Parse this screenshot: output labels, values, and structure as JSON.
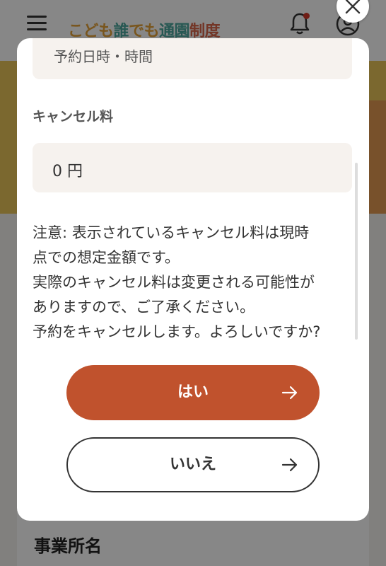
{
  "header": {
    "logo_parts": [
      "こども",
      "誰",
      "でも",
      "通園",
      "制度"
    ]
  },
  "background": {
    "section_title": "事業所名"
  },
  "modal": {
    "previous_field_value": "予約日時・時間",
    "cancel_fee_label": "キャンセル料",
    "cancel_fee_value": "0 円",
    "notice_lines": [
      "注意: 表示されているキャンセル料は現時",
      "点での想定金額です。",
      "実際のキャンセル料は変更される可能性が",
      "ありますので、ご了承ください。",
      "予約をキャンセルします。よろしいですか?"
    ],
    "yes_label": "はい",
    "no_label": "いいえ"
  },
  "icons": {
    "menu": "hamburger-icon",
    "notification": "bell-icon",
    "account": "user-icon",
    "close": "close-icon",
    "arrow": "arrow-right-icon"
  },
  "colors": {
    "primary": "#c0522d",
    "field_bg": "#f6f2ee",
    "hero": "#e8c45a",
    "badge": "#d43a2a"
  }
}
